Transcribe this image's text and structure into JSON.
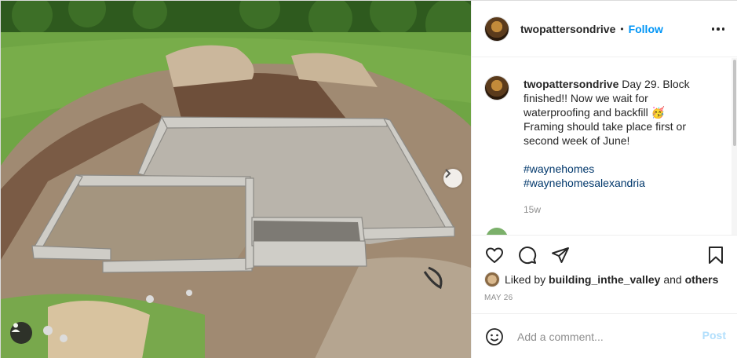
{
  "post": {
    "username": "twopattersondrive",
    "follow_label": "Follow",
    "header_separator": "•",
    "caption_text": "Day 29. Block finished!! Now we wait for waterproofing and backfill 🥳 Framing should take place first or second week of June!",
    "hashtags": [
      "#waynehomes",
      "#waynehomesalexandria"
    ],
    "age": "15w",
    "liked_by_prefix": "Liked by",
    "liked_by_user": "building_inthe_valley",
    "liked_by_and": "and",
    "liked_by_others": "others",
    "date": "MAY 26"
  },
  "composer": {
    "placeholder": "Add a comment...",
    "post_label": "Post"
  },
  "icons": {
    "more": "more-options-icon",
    "like": "heart-icon",
    "comment": "comment-icon",
    "share": "paper-plane-icon",
    "save": "bookmark-icon",
    "emoji": "smiley-icon",
    "next": "chevron-right-icon",
    "tags": "user-tag-icon"
  },
  "colors": {
    "accent": "#0095f6",
    "hashtag": "#00376b",
    "muted": "#8e8e8e",
    "post_disabled": "#b2dffc"
  }
}
